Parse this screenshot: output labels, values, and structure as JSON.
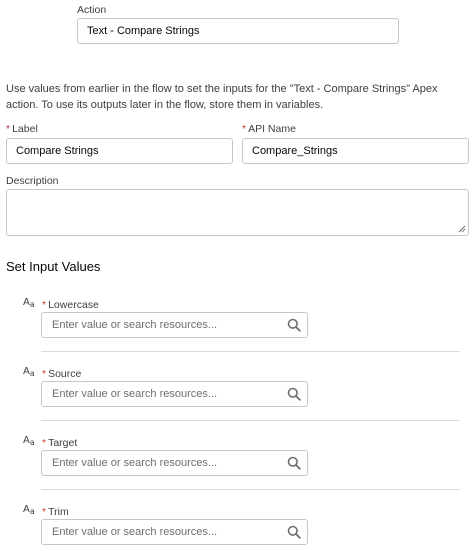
{
  "action": {
    "label": "Action",
    "value": "Text - Compare Strings"
  },
  "help_text": "Use values from earlier in the flow to set the inputs for the \"Text - Compare Strings\" Apex action. To use its outputs later in the flow, store them in variables.",
  "fields": {
    "label": {
      "label": "Label",
      "required_mark": "*",
      "value": "Compare Strings"
    },
    "api_name": {
      "label": "API Name",
      "required_mark": "*",
      "value": "Compare_Strings"
    },
    "description": {
      "label": "Description",
      "value": ""
    }
  },
  "inputs_section": {
    "title": "Set Input Values",
    "type_icon_main": "A",
    "type_icon_sub": "a",
    "placeholder": "Enter value or search resources...",
    "params": [
      {
        "label": "Lowercase",
        "required_mark": "*"
      },
      {
        "label": "Source",
        "required_mark": "*"
      },
      {
        "label": "Target",
        "required_mark": "*"
      },
      {
        "label": "Trim",
        "required_mark": "*"
      }
    ]
  },
  "icons": {
    "search": "search-icon",
    "text_type": "text-type-icon",
    "resize": "resize-handle-icon"
  }
}
